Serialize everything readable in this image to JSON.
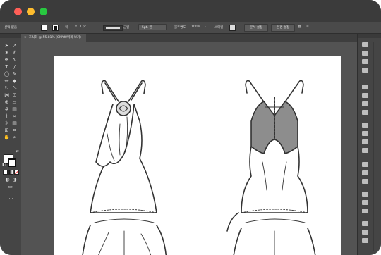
{
  "window": {
    "controls": [
      "close",
      "minimize",
      "maximize"
    ],
    "colors": {
      "close": "#ff5f57",
      "minimize": "#febc2e",
      "maximize": "#28c840"
    }
  },
  "control_bar": {
    "selection_label": "선택 없음",
    "stroke_label": "획",
    "stroke_weight": "1 pt",
    "stroke_style": "균일",
    "brush": "5pt. 원",
    "opacity_label": "불투명도",
    "opacity_value": "100%",
    "style_label": "스타일",
    "doc_setup_button": "문서 설정",
    "prefs_button": "환경 설정"
  },
  "document_tab": {
    "title": "조식화 @ 55.81% (CMYK/미리 보기)",
    "close_glyph": "×"
  },
  "toolbar": {
    "more_glyph": "···"
  }
}
